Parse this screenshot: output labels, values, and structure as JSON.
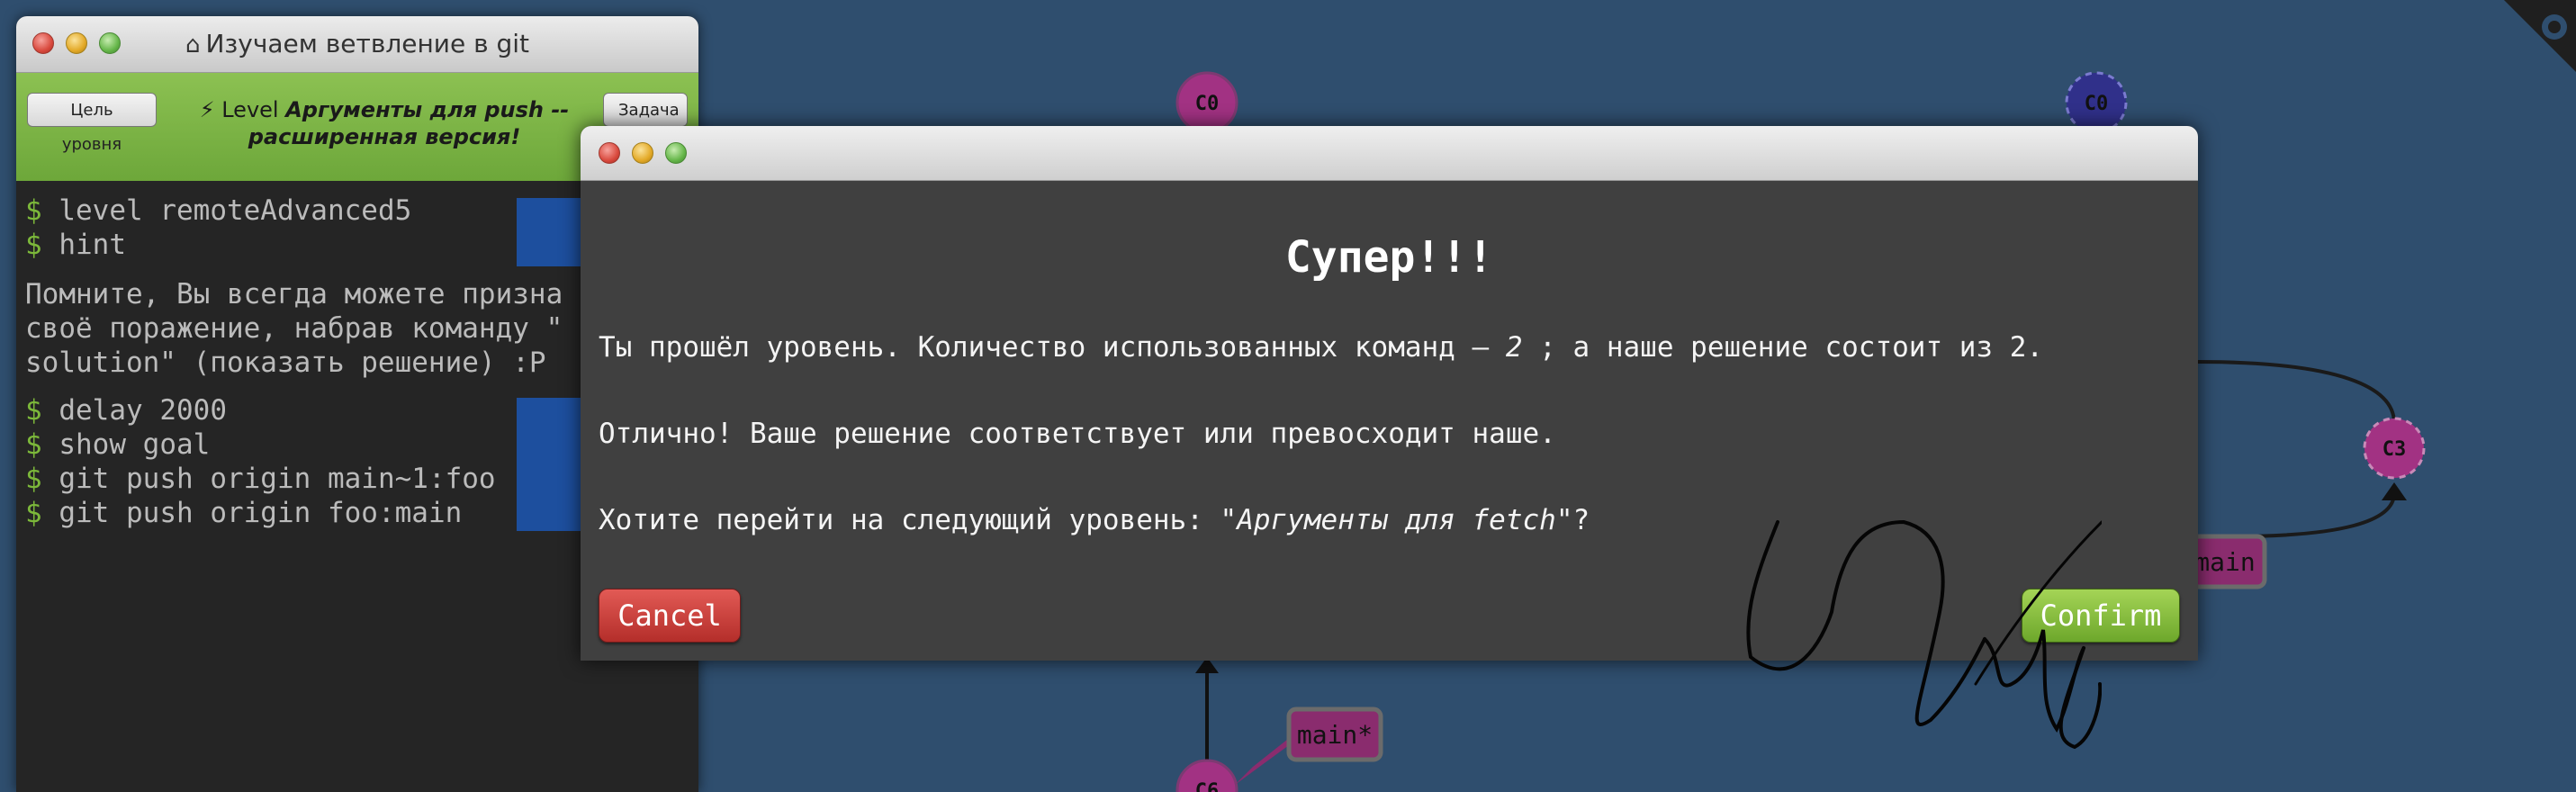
{
  "terminal": {
    "title": "Изучаем ветвление в git",
    "goal_button": "Цель уровня",
    "task_button": "Задача",
    "level_prefix": "Level",
    "level_name": "Аргументы для push -- расширенная версия!",
    "commands_a": [
      {
        "prompt": "$",
        "text": "level remoteAdvanced5"
      },
      {
        "prompt": "$",
        "text": "hint"
      }
    ],
    "hint_lines": [
      "Помните, Вы всегда можете призна",
      "своё поражение, набрав команду \"",
      "solution\" (показать решение) :P"
    ],
    "commands_b": [
      {
        "prompt": "$",
        "text": "delay 2000"
      },
      {
        "prompt": "$",
        "text": "show goal"
      },
      {
        "prompt": "$",
        "text": "git push origin main~1:foo"
      },
      {
        "prompt": "$",
        "text": "git push origin foo:main"
      }
    ]
  },
  "graph": {
    "nodes": [
      {
        "id": "C0",
        "label": "C0"
      },
      {
        "id": "C0-remote",
        "label": "C0"
      },
      {
        "id": "C3",
        "label": "C3"
      },
      {
        "id": "C6",
        "label": "C6"
      }
    ],
    "branches": [
      {
        "id": "main-remote",
        "label": "main"
      },
      {
        "id": "main-local",
        "label": "main*"
      }
    ],
    "colors": {
      "node": "#a23283",
      "remote_node": "#30308a",
      "branch": "#8a2c6e",
      "background": "#2f4e6e"
    }
  },
  "modal": {
    "heading": "Супер!!!",
    "line1_before": "Ты прошёл уровень. Количество использованных команд — ",
    "line1_count": "2",
    "line1_after": " ; а наше решение состоит из 2.",
    "line2": "Отлично! Ваше решение соответствует или превосходит наше.",
    "line3_before": "Хотите перейти на следующий уровень: \"",
    "line3_level": "Аргументы для fetch",
    "line3_after": "\"?",
    "cancel_label": "Cancel",
    "confirm_label": "Confirm",
    "colors": {
      "cancel": "#c2403b",
      "confirm": "#86bc3e"
    }
  }
}
